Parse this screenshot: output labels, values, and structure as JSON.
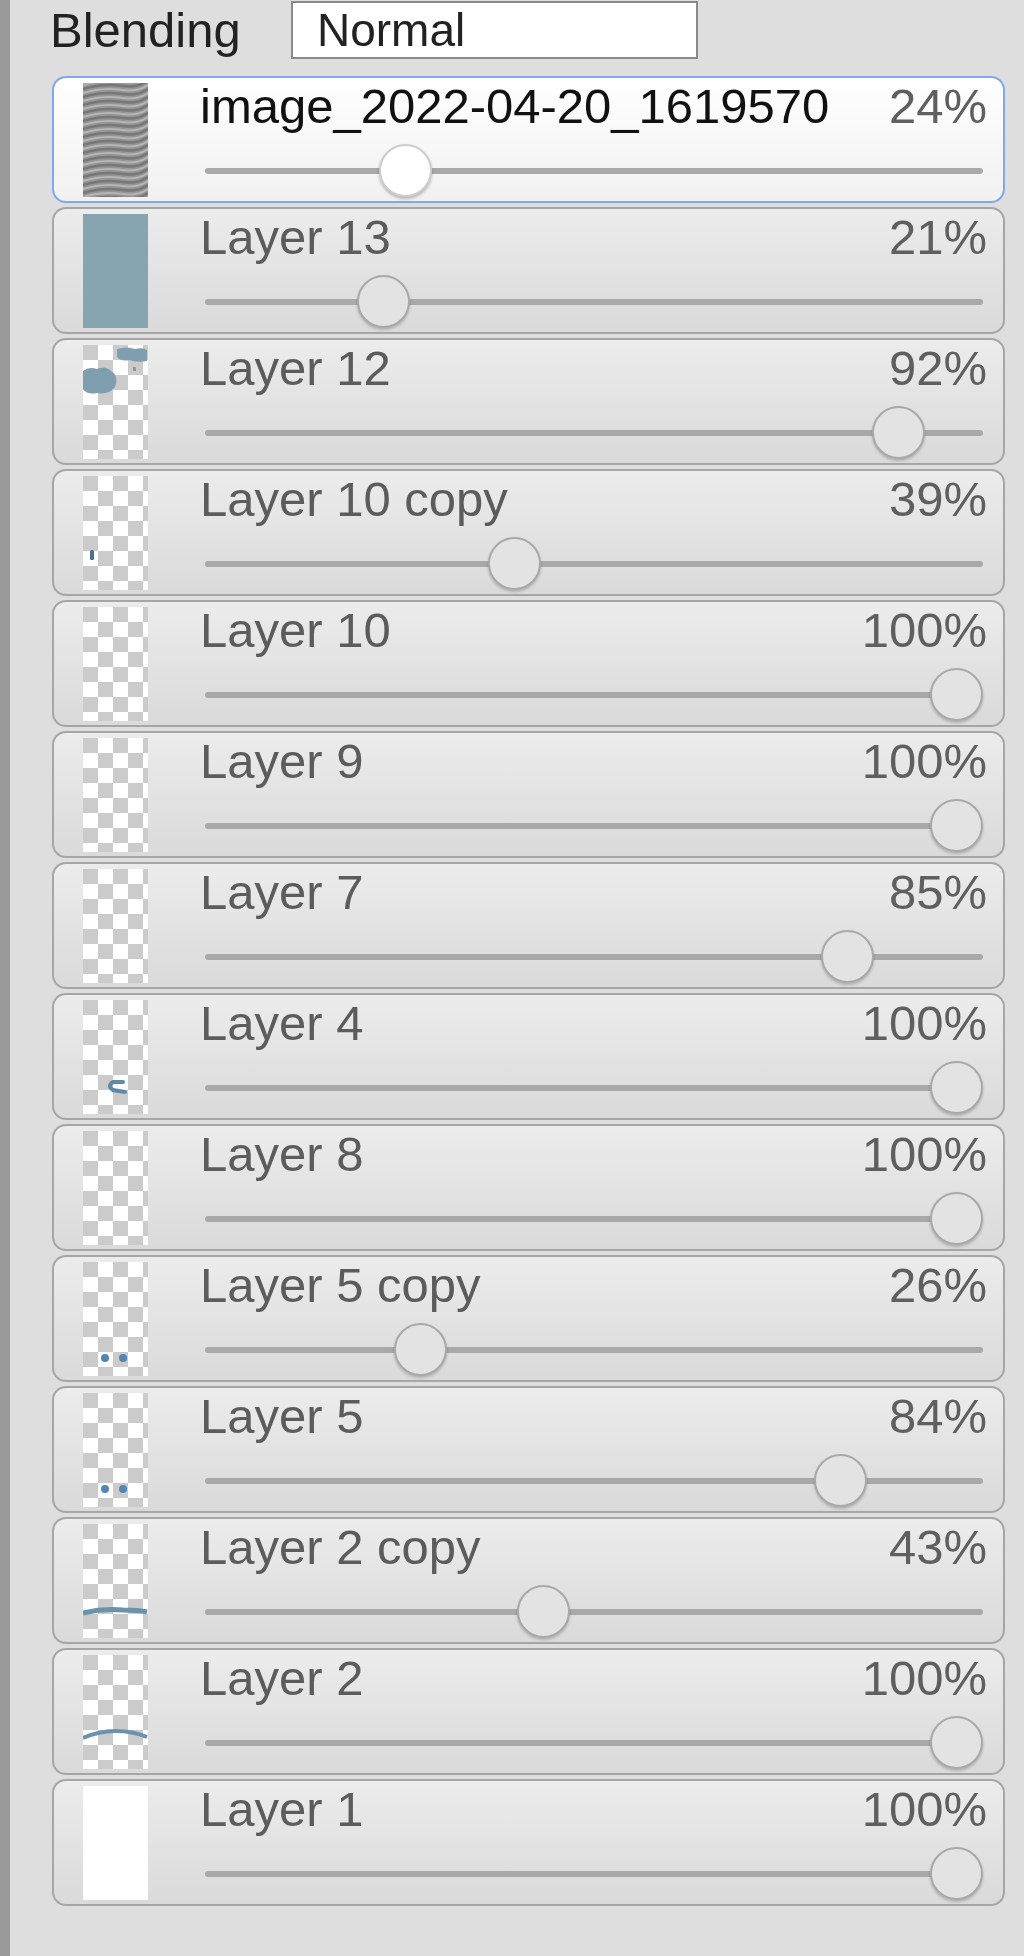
{
  "blending": {
    "label": "Blending",
    "value": "Normal"
  },
  "layers": [
    {
      "name": "image_2022-04-20_1619570",
      "opacity": "24%",
      "level": 0.24,
      "selected": true,
      "thumbnail": {
        "kind": "stripes"
      }
    },
    {
      "name": "Layer 13",
      "opacity": "21%",
      "level": 0.21,
      "selected": false,
      "thumbnail": {
        "kind": "solid",
        "color": "#87a4b1"
      }
    },
    {
      "name": "Layer 12",
      "opacity": "92%",
      "level": 0.92,
      "selected": false,
      "thumbnail": {
        "kind": "blob"
      }
    },
    {
      "name": "Layer 10 copy",
      "opacity": "39%",
      "level": 0.39,
      "selected": false,
      "thumbnail": {
        "kind": "speck"
      }
    },
    {
      "name": "Layer 10",
      "opacity": "100%",
      "level": 1,
      "selected": false,
      "thumbnail": {
        "kind": "checker"
      }
    },
    {
      "name": "Layer 9",
      "opacity": "100%",
      "level": 1,
      "selected": false,
      "thumbnail": {
        "kind": "checker"
      }
    },
    {
      "name": "Layer 7",
      "opacity": "85%",
      "level": 0.85,
      "selected": false,
      "thumbnail": {
        "kind": "checker"
      }
    },
    {
      "name": "Layer 4",
      "opacity": "100%",
      "level": 1,
      "selected": false,
      "thumbnail": {
        "kind": "hook"
      }
    },
    {
      "name": "Layer 8",
      "opacity": "100%",
      "level": 1,
      "selected": false,
      "thumbnail": {
        "kind": "checker"
      }
    },
    {
      "name": "Layer 5 copy",
      "opacity": "26%",
      "level": 0.26,
      "selected": false,
      "thumbnail": {
        "kind": "dots"
      }
    },
    {
      "name": "Layer 5",
      "opacity": "84%",
      "level": 0.84,
      "selected": false,
      "thumbnail": {
        "kind": "dots"
      }
    },
    {
      "name": "Layer 2 copy",
      "opacity": "43%",
      "level": 0.43,
      "selected": false,
      "thumbnail": {
        "kind": "line"
      }
    },
    {
      "name": "Layer 2",
      "opacity": "100%",
      "level": 1,
      "selected": false,
      "thumbnail": {
        "kind": "curve"
      }
    },
    {
      "name": "Layer 1",
      "opacity": "100%",
      "level": 1,
      "selected": false,
      "thumbnail": {
        "kind": "solid",
        "color": "#ffffff"
      }
    }
  ]
}
